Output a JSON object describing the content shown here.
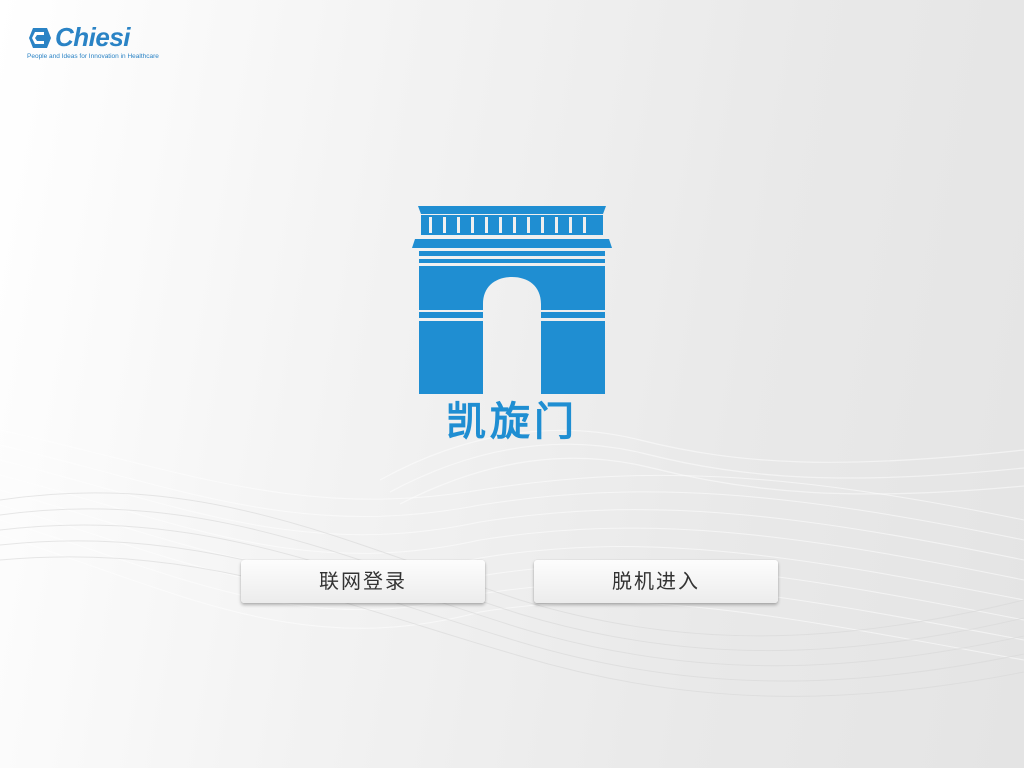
{
  "brand": {
    "name": "Chiesi",
    "tagline": "People and Ideas for Innovation in Healthcare",
    "logo_icon": "chiesi-logo-mark",
    "color": "#2a83c5"
  },
  "app": {
    "title": "凯旋门",
    "logo_icon": "arc-de-triomphe-icon",
    "accent_color": "#1f8ed2"
  },
  "actions": {
    "online_login_label": "联网登录",
    "offline_enter_label": "脱机进入"
  }
}
